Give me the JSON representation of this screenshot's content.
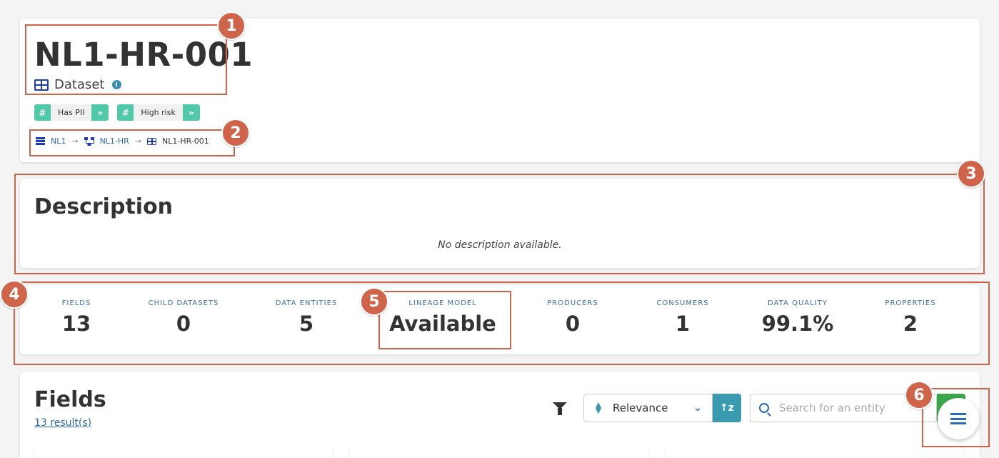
{
  "header": {
    "title": "NL1-HR-001",
    "type_label": "Dataset",
    "info_icon": "info-icon",
    "tags": [
      {
        "label": "Has PII"
      },
      {
        "label": "High risk"
      }
    ],
    "breadcrumb": [
      {
        "label": "NL1",
        "icon": "database-icon"
      },
      {
        "label": "NL1-HR",
        "icon": "hierarchy-icon"
      },
      {
        "label": "NL1-HR-001",
        "icon": "dataset-icon"
      }
    ]
  },
  "description": {
    "title": "Description",
    "empty_text": "No description available."
  },
  "stats": [
    {
      "label": "FIELDS",
      "value": "13"
    },
    {
      "label": "CHILD DATASETS",
      "value": "0"
    },
    {
      "label": "DATA ENTITIES",
      "value": "5"
    },
    {
      "label": "LINEAGE MODEL",
      "value": "Available"
    },
    {
      "label": "PRODUCERS",
      "value": "0"
    },
    {
      "label": "CONSUMERS",
      "value": "1"
    },
    {
      "label": "DATA QUALITY",
      "value": "99.1%"
    },
    {
      "label": "PROPERTIES",
      "value": "2"
    }
  ],
  "fields": {
    "title": "Fields",
    "result_count": "13 result(s)",
    "sort_value": "Relevance",
    "search_placeholder": "Search for an entity"
  },
  "annotations": [
    "1",
    "2",
    "3",
    "4",
    "5",
    "6"
  ],
  "colors": {
    "accent_blue": "#2a6ab5",
    "tag_green": "#4fc9a8",
    "teal_button": "#3a9bb0",
    "search_green": "#3aa84a",
    "annotation_orange": "#d0644a"
  }
}
